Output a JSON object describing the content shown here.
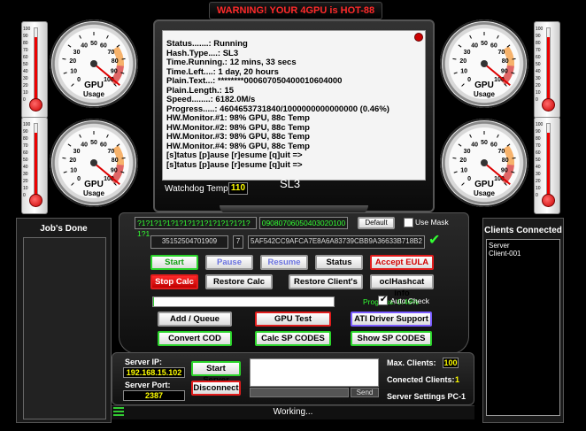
{
  "warning": "WARNING! YOUR 4GPU is HOT-88",
  "gauges": {
    "label_main": "GPU",
    "label_sub": "Usage",
    "scale": [
      "0",
      "10",
      "20",
      "30",
      "40",
      "50",
      "60",
      "70",
      "80",
      "90",
      "100"
    ],
    "usage_percent": 98
  },
  "thermometers": {
    "scale": [
      "100",
      "90",
      "80",
      "70",
      "60",
      "50",
      "40",
      "30",
      "20",
      "10",
      "0"
    ],
    "level_percent": 88
  },
  "screen": {
    "lines": [
      "Status.......: Running",
      "Hash.Type....: SL3",
      "Time.Running.: 12 mins, 33 secs",
      "Time.Left....: 1 day, 20 hours",
      "Plain.Text...: ********000607050400010604000",
      "Plain.Length.: 15",
      "Speed........: 6182.0M/s",
      "Progress.....: 4604653731840/1000000000000000 (0.46%)",
      "HW.Monitor.#1: 98% GPU, 88c Temp",
      "HW.Monitor.#2: 98% GPU, 88c Temp",
      "HW.Monitor.#3: 98% GPU, 88c Temp",
      "HW.Monitor.#4: 98% GPU, 88c Temp",
      "[s]tatus [p]ause [r]esume [q]uit =>",
      "[s]tatus [p]ause [r]esume [q]uit =>"
    ],
    "watchdog_label": "Watchdog Temp:",
    "watchdog_value": "110",
    "brand": "SL3"
  },
  "jobs_panel": {
    "title": "Job's Done"
  },
  "clients_panel": {
    "title": "Clients Connected",
    "items": [
      "Server",
      "Client-001"
    ]
  },
  "console": {
    "mask_field": "?1?1?1?1?1?1?1?1?1?1?1?1?1?1?1",
    "mask_value": "09080706050403020100",
    "default_button": "Default",
    "use_mask_label": "Use Mask",
    "imei": "35152504701909",
    "digit": "7",
    "hash": "5AF542CC9AFCA7E8A6A83739CBB9A36633B718B2",
    "buttons": {
      "start": "Start",
      "pause": "Pause",
      "resume": "Resume",
      "status": "Status",
      "accept_eula": "Accept EULA",
      "stop_calc": "Stop Calc",
      "restore_calc": "Restore Calc",
      "restore_clients": "Restore Client's",
      "oclhashcat_info": "oclHashcat info",
      "add_queue": "Add / Queue",
      "gpu_test": "GPU Test",
      "ati_driver": "ATI Driver Support",
      "convert_cod": "Convert COD",
      "calc_sp": "Calc SP CODES",
      "show_sp": "Show SP CODES"
    },
    "progress_label": "Progress: 0.46%",
    "progress_percent": 0.46,
    "auto_check_label": "Auto Check"
  },
  "server": {
    "ip_label": "Server IP:",
    "ip_value": "192.168.15.102",
    "port_label": "Server Port:",
    "port_value": "2387",
    "start_button": "Start Server",
    "disconnect_button": "Disconnect",
    "send_button": "Send",
    "max_clients_label": "Max. Clients:",
    "max_clients_value": "100",
    "connected_label": "Conected Clients:",
    "connected_value": "1",
    "settings_label": "Server Settings PC-1"
  },
  "status_bar": "Working...",
  "colors": {
    "accent_green": "#2bd42b",
    "accent_red": "#e01c1c",
    "accent_purple": "#7a5cff",
    "warning_red": "#ff2a2a"
  }
}
